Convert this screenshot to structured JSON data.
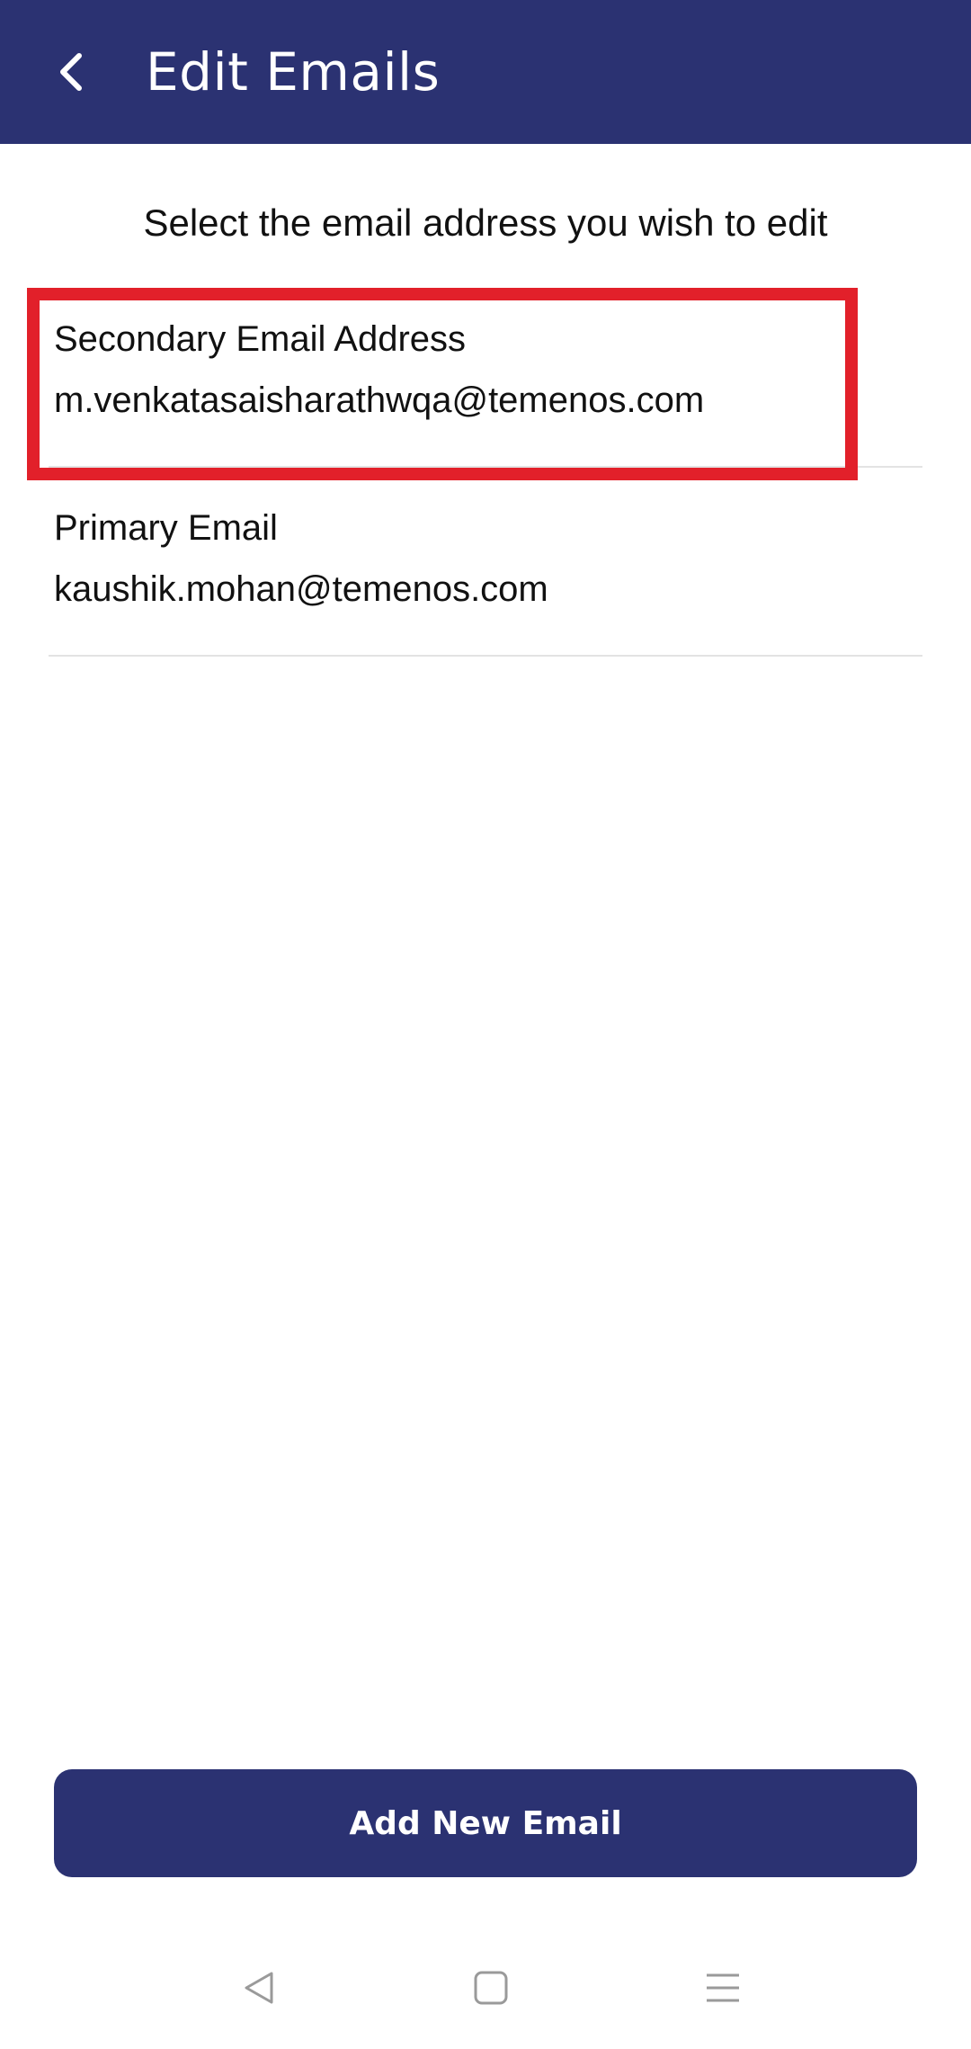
{
  "header": {
    "title": "Edit Emails",
    "back_icon": "chevron-left-icon",
    "background_color": "#2b3272"
  },
  "instruction": "Select the email address you wish to edit",
  "emails": [
    {
      "label": "Secondary Email Address",
      "address": "m.venkatasaisharathwqa@temenos.com",
      "highlighted": true
    },
    {
      "label": "Primary Email",
      "address": "kaushik.mohan@temenos.com",
      "highlighted": false
    }
  ],
  "highlight_color": "#e2202a",
  "add_button": {
    "label": "Add New Email",
    "color": "#2b3272"
  },
  "system_nav": {
    "back_icon": "triangle-back-icon",
    "home_icon": "square-home-icon",
    "menu_icon": "hamburger-menu-icon"
  }
}
